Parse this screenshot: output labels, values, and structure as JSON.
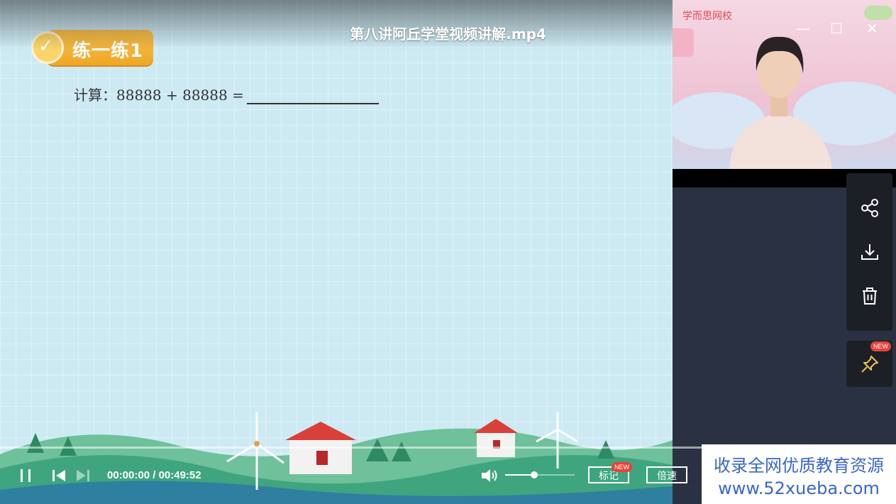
{
  "window": {
    "title": "第八讲阿丘学堂视频讲解.mp4",
    "minimize_glyph": "—",
    "maximize_glyph": "☐",
    "close_glyph": "✕"
  },
  "slide": {
    "badge_label": "练一练1",
    "question_prefix": "计算：",
    "question_expr": "88888 + 88888 ="
  },
  "camera": {
    "brand": "学而思网校"
  },
  "player": {
    "current_time": "00:00:00",
    "separator": " / ",
    "total_time": "00:49:52",
    "progress_fraction": 0.0,
    "volume_fraction": 0.42,
    "mark_label": "标记",
    "mark_new": "NEW",
    "speed_label": "倍速"
  },
  "side_panel": {
    "icons": [
      "share-icon",
      "download-icon",
      "trash-icon"
    ],
    "pin_new": "NEW"
  },
  "watermark": {
    "line1": "收录全网优质教育资源",
    "line2": "www.52xueba.com"
  }
}
